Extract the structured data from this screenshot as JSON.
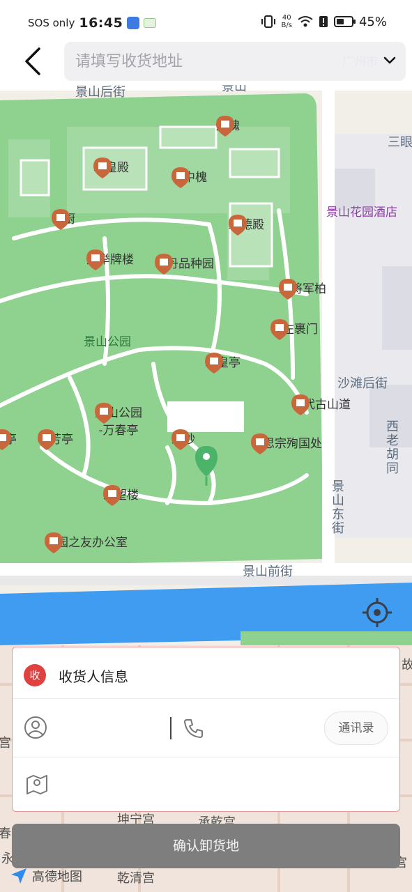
{
  "status_bar": {
    "carrier": "SOS only",
    "time": "16:45",
    "net_speed_value": "40",
    "net_speed_unit": "B/s",
    "battery": "45%"
  },
  "header": {
    "search_placeholder": "请填写收货地址",
    "city": "广州市"
  },
  "map": {
    "streets": {
      "top": "景山后街",
      "top_right": "景山",
      "shatan": "沙滩后街",
      "front": "景山前街",
      "east": "景山东街",
      "xilao": "西老胡同",
      "sanyan": "三眼"
    },
    "hotel": "景山花园酒店",
    "park": "景山公园",
    "pois": [
      {
        "name": "唐槐"
      },
      {
        "name": "寿皇殿"
      },
      {
        "name": "槐中槐"
      },
      {
        "name": "神厨"
      },
      {
        "name": "观德殿"
      },
      {
        "name": "九举牌楼"
      },
      {
        "name": "牡丹品种园"
      },
      {
        "name": "二将军柏"
      },
      {
        "name": "山左裹门"
      },
      {
        "name": "寿皇亭"
      },
      {
        "name": "明代古山道"
      },
      {
        "name": "景山公园"
      },
      {
        "name": "-万春亭"
      },
      {
        "name": "观妙"
      },
      {
        "name": "明思宗殉国处"
      },
      {
        "name": "览亭"
      },
      {
        "name": "辑芳亭"
      },
      {
        "name": "绮望楼"
      },
      {
        "name": "公园之友办公室"
      }
    ],
    "bottom_labels": {
      "kunning": "坤宁宫",
      "qianqing": "乾清宫",
      "chengqian": "承乾宫",
      "ningshou": "宁寿宫",
      "gu": "故",
      "gong": "宫",
      "chun": "春",
      "yong": "永"
    }
  },
  "card": {
    "badge": "收",
    "title": "收货人信息",
    "name_value": "",
    "phone_value": "",
    "contacts_label": "通讯录",
    "address_value": ""
  },
  "confirm_label": "确认卸货地",
  "logo_text": "高德地图",
  "colors": {
    "park_green": "#8fd18f",
    "water_blue": "#3f9cf0",
    "poi_orange": "#c9673c",
    "badge_red": "#e0403e",
    "button_gray": "#7e7e7e"
  }
}
